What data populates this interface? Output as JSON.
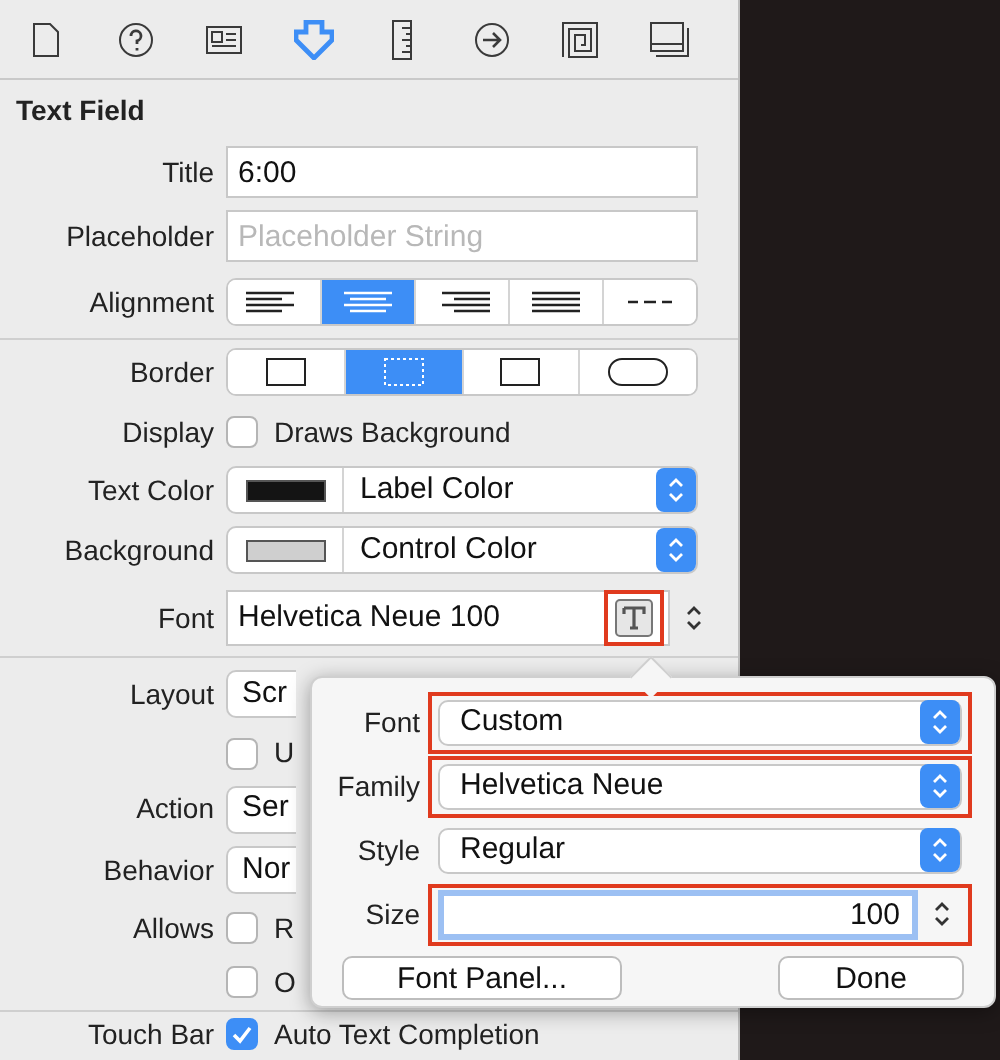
{
  "toolbar": {
    "tabs": [
      {
        "kind": "document",
        "selected": false
      },
      {
        "kind": "help",
        "selected": false
      },
      {
        "kind": "card",
        "selected": false
      },
      {
        "kind": "shield",
        "selected": true
      },
      {
        "kind": "ruler",
        "selected": false
      },
      {
        "kind": "arrow",
        "selected": false
      },
      {
        "kind": "spiral",
        "selected": false
      },
      {
        "kind": "window",
        "selected": false
      }
    ]
  },
  "section_title": "Text Field",
  "groups": [
    [
      {
        "kind": "text",
        "label": "Title",
        "value": "6:00"
      },
      {
        "kind": "text",
        "label": "Placeholder",
        "placeholder": "Placeholder String"
      },
      {
        "kind": "segmented",
        "label": "Alignment",
        "segments": [
          {
            "kind": "left",
            "selected": false
          },
          {
            "kind": "center",
            "selected": true
          },
          {
            "kind": "right",
            "selected": false
          },
          {
            "kind": "justify",
            "selected": false
          },
          {
            "kind": "natural",
            "selected": false
          }
        ]
      }
    ],
    [
      {
        "kind": "segmented",
        "label": "Border",
        "segments": [
          {
            "kind": "plain",
            "selected": false
          },
          {
            "kind": "dotted",
            "selected": true
          },
          {
            "kind": "line",
            "selected": false
          },
          {
            "kind": "rounded",
            "selected": false
          }
        ]
      },
      {
        "kind": "checkbox",
        "label": "Display",
        "text": "Draws Background",
        "checked": false
      },
      {
        "kind": "color",
        "label": "Text Color",
        "color": "#141414",
        "value": "Label Color"
      },
      {
        "kind": "color",
        "label": "Background",
        "color": "#cfcfcf",
        "value": "Control Color"
      },
      {
        "kind": "font",
        "label": "Font",
        "value": "Helvetica Neue 100",
        "highlighted": true
      }
    ],
    [
      {
        "kind": "popup",
        "label": "Layout",
        "value": "Scr"
      },
      {
        "kind": "checkbox",
        "text": "U",
        "checked": false
      },
      {
        "kind": "popup",
        "label": "Action",
        "value": "Ser"
      },
      {
        "kind": "popup",
        "label": "Behavior",
        "value": "Nor"
      },
      {
        "kind": "checkbox",
        "label": "Allows",
        "text": "R",
        "checked": false
      },
      {
        "kind": "checkbox",
        "text": "O",
        "checked": false
      }
    ],
    [
      {
        "kind": "checkbox",
        "label": "Touch Bar",
        "text": "Auto Text Completion",
        "checked": true
      }
    ]
  ],
  "popover": {
    "rows": [
      {
        "kind": "popup",
        "label": "Font",
        "value": "Custom",
        "highlighted": true
      },
      {
        "kind": "popup",
        "label": "Family",
        "value": "Helvetica Neue",
        "highlighted": true
      },
      {
        "kind": "popup",
        "label": "Style",
        "value": "Regular",
        "highlighted": false
      },
      {
        "kind": "stepper",
        "label": "Size",
        "value": "100",
        "highlighted": true,
        "focused": true
      }
    ],
    "buttons": [
      "Font Panel...",
      "Done"
    ]
  }
}
